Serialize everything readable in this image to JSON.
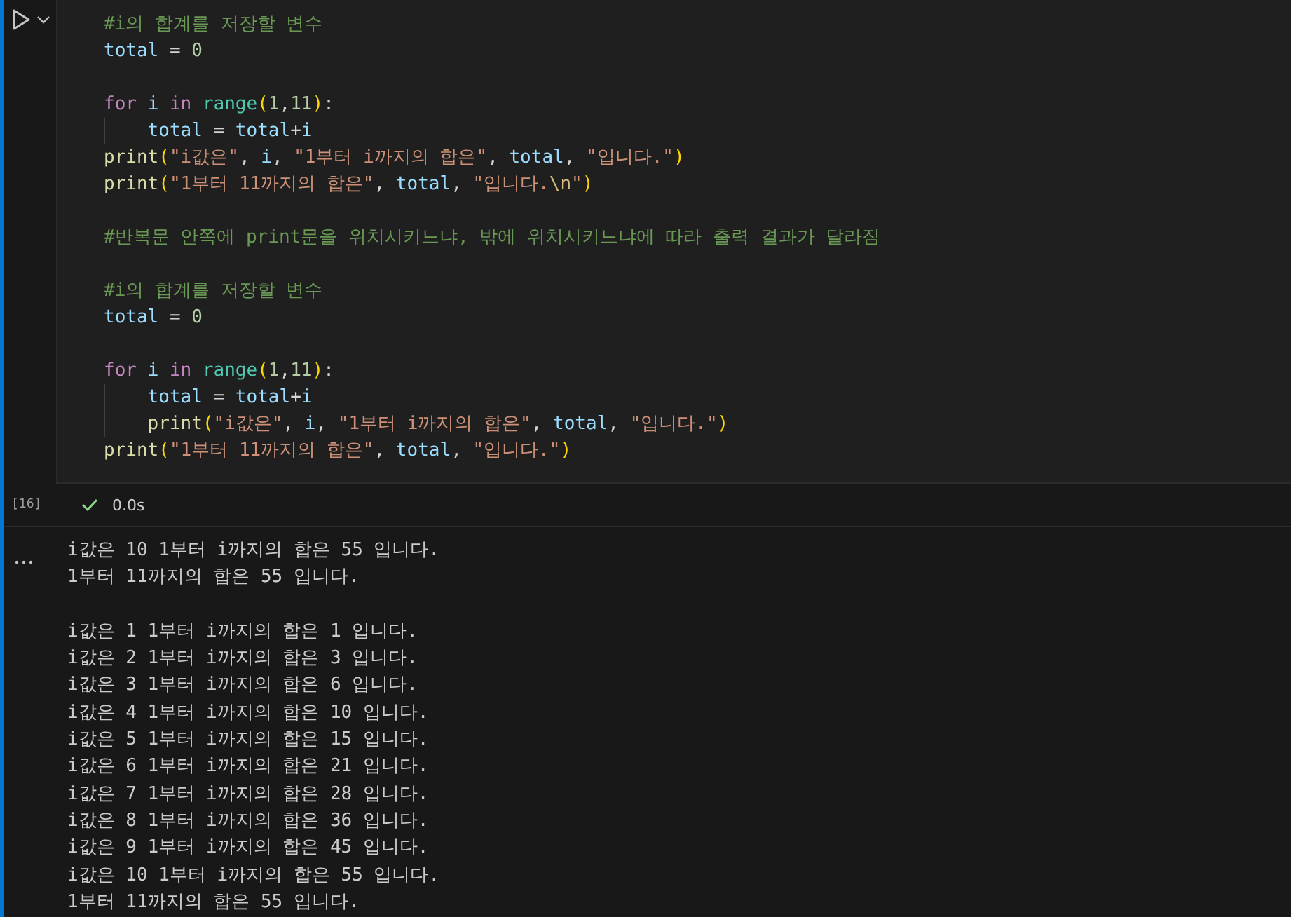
{
  "cell": {
    "execution_count": "[16]",
    "duration": "0.0s",
    "succeeded": true,
    "code_lines": [
      {
        "kind": "code",
        "indented": false,
        "tokens": [
          {
            "kind": "comment",
            "text": "#i의 합계를 저장할 변수"
          }
        ]
      },
      {
        "kind": "code",
        "indented": false,
        "tokens": [
          {
            "kind": "var",
            "text": "total"
          },
          {
            "kind": "op",
            "text": " = "
          },
          {
            "kind": "num",
            "text": "0"
          }
        ]
      },
      {
        "kind": "blank"
      },
      {
        "kind": "code",
        "indented": false,
        "tokens": [
          {
            "kind": "keyword",
            "text": "for "
          },
          {
            "kind": "var",
            "text": "i "
          },
          {
            "kind": "keyword",
            "text": "in "
          },
          {
            "kind": "builtin",
            "text": "range"
          },
          {
            "kind": "paren",
            "text": "("
          },
          {
            "kind": "num",
            "text": "1"
          },
          {
            "kind": "op",
            "text": ","
          },
          {
            "kind": "num",
            "text": "11"
          },
          {
            "kind": "paren",
            "text": ")"
          },
          {
            "kind": "op",
            "text": ":"
          }
        ]
      },
      {
        "kind": "code",
        "indented": true,
        "tokens": [
          {
            "kind": "var",
            "text": "total"
          },
          {
            "kind": "op",
            "text": " = "
          },
          {
            "kind": "var",
            "text": "total"
          },
          {
            "kind": "op",
            "text": "+"
          },
          {
            "kind": "var",
            "text": "i"
          }
        ]
      },
      {
        "kind": "code",
        "indented": false,
        "tokens": [
          {
            "kind": "func",
            "text": "print"
          },
          {
            "kind": "paren",
            "text": "("
          },
          {
            "kind": "str",
            "text": "\"i값은\""
          },
          {
            "kind": "op",
            "text": ", "
          },
          {
            "kind": "var",
            "text": "i"
          },
          {
            "kind": "op",
            "text": ", "
          },
          {
            "kind": "str",
            "text": "\"1부터 i까지의 합은\""
          },
          {
            "kind": "op",
            "text": ", "
          },
          {
            "kind": "var",
            "text": "total"
          },
          {
            "kind": "op",
            "text": ", "
          },
          {
            "kind": "str",
            "text": "\"입니다.\""
          },
          {
            "kind": "paren",
            "text": ")"
          }
        ]
      },
      {
        "kind": "code",
        "indented": false,
        "tokens": [
          {
            "kind": "func",
            "text": "print"
          },
          {
            "kind": "paren",
            "text": "("
          },
          {
            "kind": "str",
            "text": "\"1부터 11까지의 합은\""
          },
          {
            "kind": "op",
            "text": ", "
          },
          {
            "kind": "var",
            "text": "total"
          },
          {
            "kind": "op",
            "text": ", "
          },
          {
            "kind": "str",
            "text": "\"입니다."
          },
          {
            "kind": "esc",
            "text": "\\n"
          },
          {
            "kind": "str",
            "text": "\""
          },
          {
            "kind": "paren",
            "text": ")"
          }
        ]
      },
      {
        "kind": "blank"
      },
      {
        "kind": "code",
        "indented": false,
        "tokens": [
          {
            "kind": "comment",
            "text": "#반복문 안쪽에 print문을 위치시키느냐, 밖에 위치시키느냐에 따라 출력 결과가 달라짐"
          }
        ]
      },
      {
        "kind": "blank"
      },
      {
        "kind": "code",
        "indented": false,
        "tokens": [
          {
            "kind": "comment",
            "text": "#i의 합계를 저장할 변수"
          }
        ]
      },
      {
        "kind": "code",
        "indented": false,
        "tokens": [
          {
            "kind": "var",
            "text": "total"
          },
          {
            "kind": "op",
            "text": " = "
          },
          {
            "kind": "num",
            "text": "0"
          }
        ]
      },
      {
        "kind": "blank"
      },
      {
        "kind": "code",
        "indented": false,
        "tokens": [
          {
            "kind": "keyword",
            "text": "for "
          },
          {
            "kind": "var",
            "text": "i "
          },
          {
            "kind": "keyword",
            "text": "in "
          },
          {
            "kind": "builtin",
            "text": "range"
          },
          {
            "kind": "paren",
            "text": "("
          },
          {
            "kind": "num",
            "text": "1"
          },
          {
            "kind": "op",
            "text": ","
          },
          {
            "kind": "num",
            "text": "11"
          },
          {
            "kind": "paren",
            "text": ")"
          },
          {
            "kind": "op",
            "text": ":"
          }
        ]
      },
      {
        "kind": "code",
        "indented": true,
        "tokens": [
          {
            "kind": "var",
            "text": "total"
          },
          {
            "kind": "op",
            "text": " = "
          },
          {
            "kind": "var",
            "text": "total"
          },
          {
            "kind": "op",
            "text": "+"
          },
          {
            "kind": "var",
            "text": "i"
          }
        ]
      },
      {
        "kind": "code",
        "indented": true,
        "tokens": [
          {
            "kind": "func",
            "text": "print"
          },
          {
            "kind": "paren",
            "text": "("
          },
          {
            "kind": "str",
            "text": "\"i값은\""
          },
          {
            "kind": "op",
            "text": ", "
          },
          {
            "kind": "var",
            "text": "i"
          },
          {
            "kind": "op",
            "text": ", "
          },
          {
            "kind": "str",
            "text": "\"1부터 i까지의 합은\""
          },
          {
            "kind": "op",
            "text": ", "
          },
          {
            "kind": "var",
            "text": "total"
          },
          {
            "kind": "op",
            "text": ", "
          },
          {
            "kind": "str",
            "text": "\"입니다.\""
          },
          {
            "kind": "paren",
            "text": ")"
          }
        ]
      },
      {
        "kind": "code",
        "indented": false,
        "tokens": [
          {
            "kind": "func",
            "text": "print"
          },
          {
            "kind": "paren",
            "text": "("
          },
          {
            "kind": "str",
            "text": "\"1부터 11까지의 합은\""
          },
          {
            "kind": "op",
            "text": ", "
          },
          {
            "kind": "var",
            "text": "total"
          },
          {
            "kind": "op",
            "text": ", "
          },
          {
            "kind": "str",
            "text": "\"입니다.\""
          },
          {
            "kind": "paren",
            "text": ")"
          }
        ]
      }
    ],
    "output_lines": [
      {
        "kind": "text",
        "text": "i값은 10 1부터 i까지의 합은 55 입니다."
      },
      {
        "kind": "text",
        "text": "1부터 11까지의 합은 55 입니다."
      },
      {
        "kind": "blank"
      },
      {
        "kind": "text",
        "text": "i값은 1 1부터 i까지의 합은 1 입니다."
      },
      {
        "kind": "text",
        "text": "i값은 2 1부터 i까지의 합은 3 입니다."
      },
      {
        "kind": "text",
        "text": "i값은 3 1부터 i까지의 합은 6 입니다."
      },
      {
        "kind": "text",
        "text": "i값은 4 1부터 i까지의 합은 10 입니다."
      },
      {
        "kind": "text",
        "text": "i값은 5 1부터 i까지의 합은 15 입니다."
      },
      {
        "kind": "text",
        "text": "i값은 6 1부터 i까지의 합은 21 입니다."
      },
      {
        "kind": "text",
        "text": "i값은 7 1부터 i까지의 합은 28 입니다."
      },
      {
        "kind": "text",
        "text": "i값은 8 1부터 i까지의 합은 36 입니다."
      },
      {
        "kind": "text",
        "text": "i값은 9 1부터 i까지의 합은 45 입니다."
      },
      {
        "kind": "text",
        "text": "i값은 10 1부터 i까지의 합은 55 입니다."
      },
      {
        "kind": "text",
        "text": "1부터 11까지의 합은 55 입니다."
      }
    ]
  }
}
